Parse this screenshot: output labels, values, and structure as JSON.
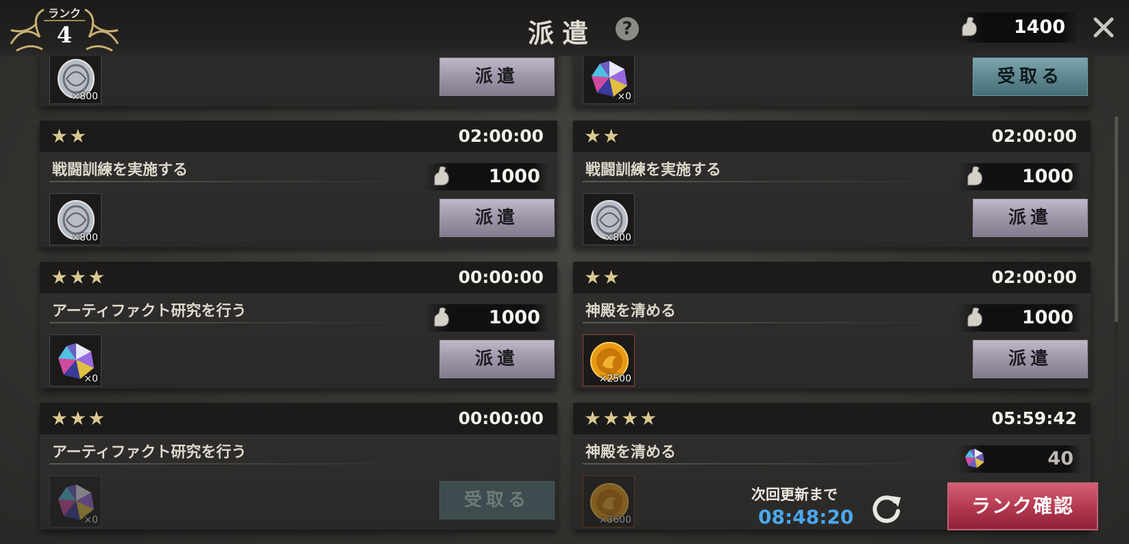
{
  "header": {
    "rank_label": "ランク",
    "rank_value": "4",
    "title": "派遣",
    "help_icon": "question-icon",
    "stamina_icon": "arm-flex-icon",
    "stamina": "1400",
    "close_icon": "close-icon"
  },
  "missions": [
    {
      "stars": "",
      "time": "",
      "name": "",
      "cost": "",
      "reward_type": "silver-coin",
      "reward_qty": "×800",
      "button": "派遣",
      "button_type": "dispatch"
    },
    {
      "stars": "",
      "time": "",
      "name": "",
      "cost": "",
      "reward_type": "rainbow-gem",
      "reward_qty": "×0",
      "button": "受取る",
      "button_type": "receive"
    },
    {
      "stars": "★★",
      "time": "02:00:00",
      "name": "戦闘訓練を実施する",
      "cost": "1000",
      "cost_icon": "arm-flex-icon",
      "reward_type": "silver-coin",
      "reward_qty": "×800",
      "button": "派遣",
      "button_type": "dispatch"
    },
    {
      "stars": "★★",
      "time": "02:00:00",
      "name": "戦闘訓練を実施する",
      "cost": "1000",
      "cost_icon": "arm-flex-icon",
      "reward_type": "silver-coin",
      "reward_qty": "×800",
      "button": "派遣",
      "button_type": "dispatch"
    },
    {
      "stars": "★★★",
      "time": "00:00:00",
      "name": "アーティファクト研究を行う",
      "cost": "1000",
      "cost_icon": "arm-flex-icon",
      "reward_type": "rainbow-gem",
      "reward_qty": "×0",
      "button": "派遣",
      "button_type": "dispatch"
    },
    {
      "stars": "★★",
      "time": "02:00:00",
      "name": "神殿を清める",
      "cost": "1000",
      "cost_icon": "arm-flex-icon",
      "reward_type": "gold-coin",
      "reward_qty": "×2500",
      "button": "派遣",
      "button_type": "dispatch"
    },
    {
      "stars": "★★★",
      "time": "00:00:00",
      "name": "アーティファクト研究を行う",
      "cost": "",
      "reward_type": "rainbow-gem",
      "reward_qty": "×0",
      "button": "受取る",
      "button_type": "disabled"
    },
    {
      "stars": "★★★★",
      "time": "05:59:42",
      "name": "神殿を清める",
      "cost": "40",
      "cost_icon": "rainbow-gem-icon",
      "reward_type": "gold-coin",
      "reward_qty": "×3600",
      "button": "",
      "button_type": "hidden"
    }
  ],
  "footer": {
    "refresh_label": "次回更新まで",
    "refresh_time": "08:48:20",
    "refresh_icon": "refresh-icon",
    "rank_button": "ランク確認"
  },
  "colors": {
    "accent_blue": "#4aa8ee",
    "rank_button": "#b2374e",
    "dispatch_button": "#9e96a8",
    "receive_button": "#5e878f",
    "star": "#d8c890"
  }
}
